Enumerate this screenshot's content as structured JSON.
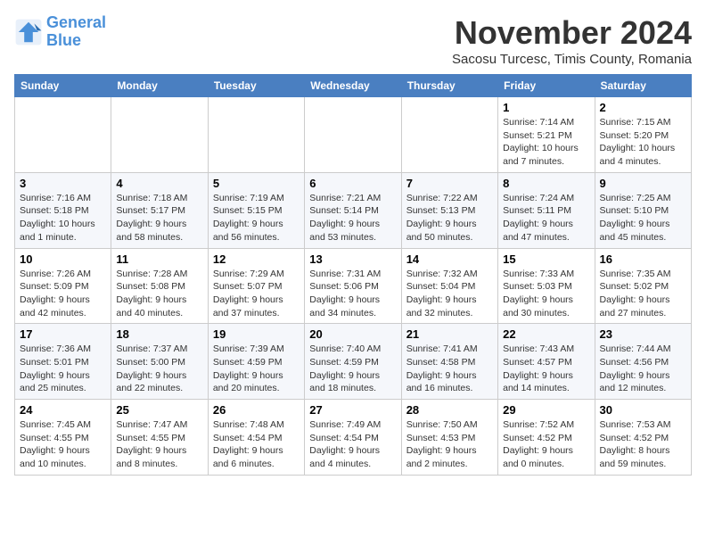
{
  "header": {
    "logo_line1": "General",
    "logo_line2": "Blue",
    "month_title": "November 2024",
    "location": "Sacosu Turcesc, Timis County, Romania"
  },
  "weekdays": [
    "Sunday",
    "Monday",
    "Tuesday",
    "Wednesday",
    "Thursday",
    "Friday",
    "Saturday"
  ],
  "weeks": [
    [
      {
        "day": "",
        "info": ""
      },
      {
        "day": "",
        "info": ""
      },
      {
        "day": "",
        "info": ""
      },
      {
        "day": "",
        "info": ""
      },
      {
        "day": "",
        "info": ""
      },
      {
        "day": "1",
        "info": "Sunrise: 7:14 AM\nSunset: 5:21 PM\nDaylight: 10 hours and 7 minutes."
      },
      {
        "day": "2",
        "info": "Sunrise: 7:15 AM\nSunset: 5:20 PM\nDaylight: 10 hours and 4 minutes."
      }
    ],
    [
      {
        "day": "3",
        "info": "Sunrise: 7:16 AM\nSunset: 5:18 PM\nDaylight: 10 hours and 1 minute."
      },
      {
        "day": "4",
        "info": "Sunrise: 7:18 AM\nSunset: 5:17 PM\nDaylight: 9 hours and 58 minutes."
      },
      {
        "day": "5",
        "info": "Sunrise: 7:19 AM\nSunset: 5:15 PM\nDaylight: 9 hours and 56 minutes."
      },
      {
        "day": "6",
        "info": "Sunrise: 7:21 AM\nSunset: 5:14 PM\nDaylight: 9 hours and 53 minutes."
      },
      {
        "day": "7",
        "info": "Sunrise: 7:22 AM\nSunset: 5:13 PM\nDaylight: 9 hours and 50 minutes."
      },
      {
        "day": "8",
        "info": "Sunrise: 7:24 AM\nSunset: 5:11 PM\nDaylight: 9 hours and 47 minutes."
      },
      {
        "day": "9",
        "info": "Sunrise: 7:25 AM\nSunset: 5:10 PM\nDaylight: 9 hours and 45 minutes."
      }
    ],
    [
      {
        "day": "10",
        "info": "Sunrise: 7:26 AM\nSunset: 5:09 PM\nDaylight: 9 hours and 42 minutes."
      },
      {
        "day": "11",
        "info": "Sunrise: 7:28 AM\nSunset: 5:08 PM\nDaylight: 9 hours and 40 minutes."
      },
      {
        "day": "12",
        "info": "Sunrise: 7:29 AM\nSunset: 5:07 PM\nDaylight: 9 hours and 37 minutes."
      },
      {
        "day": "13",
        "info": "Sunrise: 7:31 AM\nSunset: 5:06 PM\nDaylight: 9 hours and 34 minutes."
      },
      {
        "day": "14",
        "info": "Sunrise: 7:32 AM\nSunset: 5:04 PM\nDaylight: 9 hours and 32 minutes."
      },
      {
        "day": "15",
        "info": "Sunrise: 7:33 AM\nSunset: 5:03 PM\nDaylight: 9 hours and 30 minutes."
      },
      {
        "day": "16",
        "info": "Sunrise: 7:35 AM\nSunset: 5:02 PM\nDaylight: 9 hours and 27 minutes."
      }
    ],
    [
      {
        "day": "17",
        "info": "Sunrise: 7:36 AM\nSunset: 5:01 PM\nDaylight: 9 hours and 25 minutes."
      },
      {
        "day": "18",
        "info": "Sunrise: 7:37 AM\nSunset: 5:00 PM\nDaylight: 9 hours and 22 minutes."
      },
      {
        "day": "19",
        "info": "Sunrise: 7:39 AM\nSunset: 4:59 PM\nDaylight: 9 hours and 20 minutes."
      },
      {
        "day": "20",
        "info": "Sunrise: 7:40 AM\nSunset: 4:59 PM\nDaylight: 9 hours and 18 minutes."
      },
      {
        "day": "21",
        "info": "Sunrise: 7:41 AM\nSunset: 4:58 PM\nDaylight: 9 hours and 16 minutes."
      },
      {
        "day": "22",
        "info": "Sunrise: 7:43 AM\nSunset: 4:57 PM\nDaylight: 9 hours and 14 minutes."
      },
      {
        "day": "23",
        "info": "Sunrise: 7:44 AM\nSunset: 4:56 PM\nDaylight: 9 hours and 12 minutes."
      }
    ],
    [
      {
        "day": "24",
        "info": "Sunrise: 7:45 AM\nSunset: 4:55 PM\nDaylight: 9 hours and 10 minutes."
      },
      {
        "day": "25",
        "info": "Sunrise: 7:47 AM\nSunset: 4:55 PM\nDaylight: 9 hours and 8 minutes."
      },
      {
        "day": "26",
        "info": "Sunrise: 7:48 AM\nSunset: 4:54 PM\nDaylight: 9 hours and 6 minutes."
      },
      {
        "day": "27",
        "info": "Sunrise: 7:49 AM\nSunset: 4:54 PM\nDaylight: 9 hours and 4 minutes."
      },
      {
        "day": "28",
        "info": "Sunrise: 7:50 AM\nSunset: 4:53 PM\nDaylight: 9 hours and 2 minutes."
      },
      {
        "day": "29",
        "info": "Sunrise: 7:52 AM\nSunset: 4:52 PM\nDaylight: 9 hours and 0 minutes."
      },
      {
        "day": "30",
        "info": "Sunrise: 7:53 AM\nSunset: 4:52 PM\nDaylight: 8 hours and 59 minutes."
      }
    ]
  ]
}
